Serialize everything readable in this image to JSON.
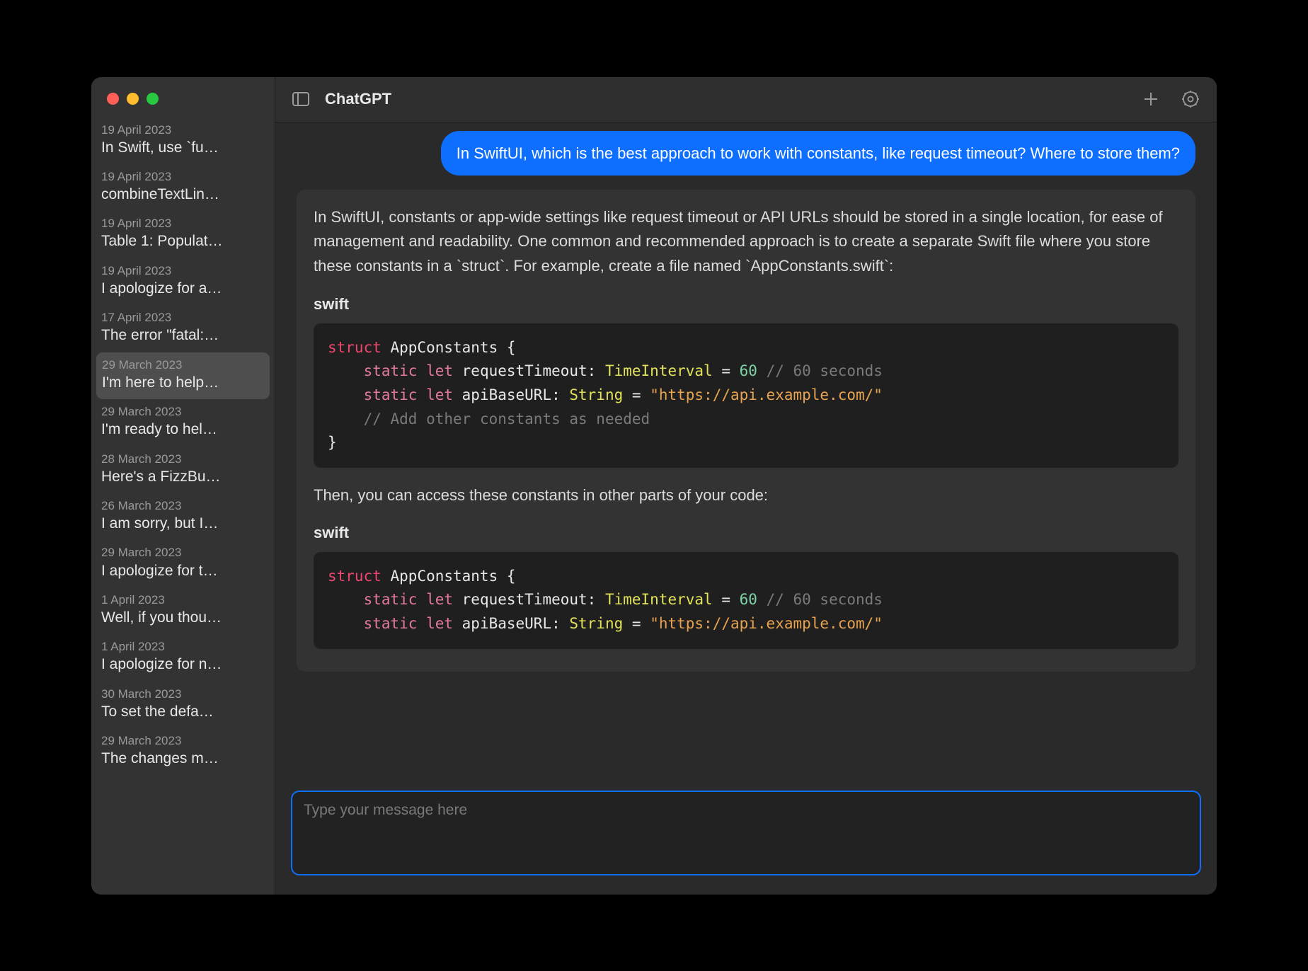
{
  "app": {
    "title": "ChatGPT"
  },
  "sidebar": {
    "items": [
      {
        "date": "19 April 2023",
        "title": "In Swift, use `fu…",
        "selected": false
      },
      {
        "date": "19 April 2023",
        "title": "combineTextLin…",
        "selected": false
      },
      {
        "date": "19 April 2023",
        "title": "Table 1: Populat…",
        "selected": false
      },
      {
        "date": "19 April 2023",
        "title": "I apologize for a…",
        "selected": false
      },
      {
        "date": "17 April 2023",
        "title": "The error \"fatal:…",
        "selected": false
      },
      {
        "date": "29 March 2023",
        "title": "I'm here to help…",
        "selected": true
      },
      {
        "date": "29 March 2023",
        "title": "I'm ready to hel…",
        "selected": false
      },
      {
        "date": "28 March 2023",
        "title": "Here's a FizzBu…",
        "selected": false
      },
      {
        "date": "26 March 2023",
        "title": "I am sorry, but I…",
        "selected": false
      },
      {
        "date": "29 March 2023",
        "title": "I apologize for t…",
        "selected": false
      },
      {
        "date": "1 April 2023",
        "title": "Well, if you thou…",
        "selected": false
      },
      {
        "date": "1 April 2023",
        "title": "I apologize for n…",
        "selected": false
      },
      {
        "date": "30 March 2023",
        "title": "To set the defa…",
        "selected": false
      },
      {
        "date": "29 March 2023",
        "title": "The changes m…",
        "selected": false
      }
    ]
  },
  "chat": {
    "user_message": "In SwiftUI, which is the best approach to work with constants, like request timeout? Where to store them?",
    "assistant": {
      "intro": "In SwiftUI, constants or app-wide settings like request timeout or API URLs should be stored in a single location, for ease of management and readability. One common and recommended approach is to create a separate Swift file where you store these constants in a `struct`. For example, create a file named `AppConstants.swift`:",
      "code_lang": "swift",
      "code1": {
        "l1_kw": "struct",
        "l1_id": " AppConstants {",
        "l2_kw": "static",
        "l2_kw2": " let",
        "l2_id": " requestTimeout:",
        "l2_type": " TimeInterval",
        "l2_rest": " = ",
        "l2_num": "60",
        "l2_cmt": " // 60 seconds",
        "l3_kw": "static",
        "l3_kw2": " let",
        "l3_id": " apiBaseURL:",
        "l3_type": " String",
        "l3_rest": " = ",
        "l3_str": "\"https://api.example.com/\"",
        "l4_cmt": "// Add other constants as needed",
        "l5": "}"
      },
      "between": "Then, you can access these constants in other parts of your code:",
      "code2": {
        "l1_kw": "struct",
        "l1_id": " AppConstants {",
        "l2_kw": "static",
        "l2_kw2": " let",
        "l2_id": " requestTimeout:",
        "l2_type": " TimeInterval",
        "l2_rest": " = ",
        "l2_num": "60",
        "l2_cmt": " // 60 seconds",
        "l3_kw": "static",
        "l3_kw2": " let",
        "l3_id": " apiBaseURL:",
        "l3_type": " String",
        "l3_rest": " = ",
        "l3_str": "\"https://api.example.com/\""
      }
    }
  },
  "input": {
    "placeholder": "Type your message here"
  }
}
